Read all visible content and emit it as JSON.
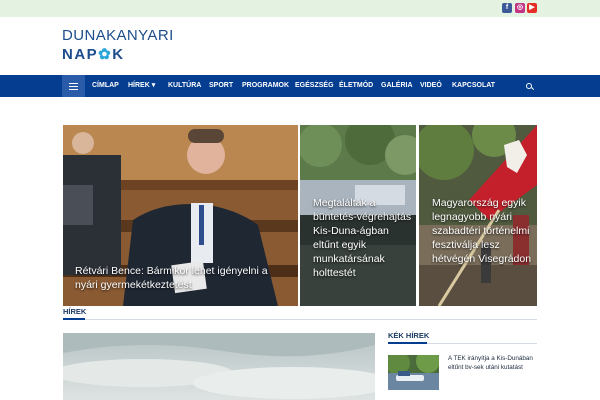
{
  "social": {
    "facebook_icon": "facebook-icon",
    "instagram_icon": "instagram-icon",
    "youtube_icon": "youtube-icon"
  },
  "logo": {
    "line1": "DUNAKANYARI",
    "line2_a": "NAP",
    "line2_star": "✿",
    "line2_b": "K"
  },
  "nav": {
    "home_icon": "menu-icon",
    "items": [
      "CÍMLAP",
      "HÍREK ▾",
      "KULTÚRA",
      "SPORT",
      "PROGRAMOK",
      "EGÉSZSÉG",
      "ÉLETMÓD",
      "GALÉRIA",
      "VIDEÓ",
      "KAPCSOLAT"
    ],
    "search_icon": "search-icon",
    "bg_color": "#053d91"
  },
  "featured": [
    {
      "title": "Rétvári Bence: Bármikor lehet igényelni a nyári gyermekétkeztetést"
    },
    {
      "title": "Megtalálták a büntetés-végrehajtás Kis-Duna-ágban eltűnt egyik munkatársának holttestét"
    },
    {
      "title": "Magyarország egyik legnagyobb nyári szabadtéri történelmi fesztiválja lesz hétvégén Visegrádon"
    }
  ],
  "news_section": {
    "label": "HÍREK"
  },
  "side_section": {
    "label": "KÉK HÍREK",
    "items": [
      {
        "text": "A TEK irányítja a Kis-Dunában eltűnt bv-sek utáni kutatást"
      }
    ]
  }
}
